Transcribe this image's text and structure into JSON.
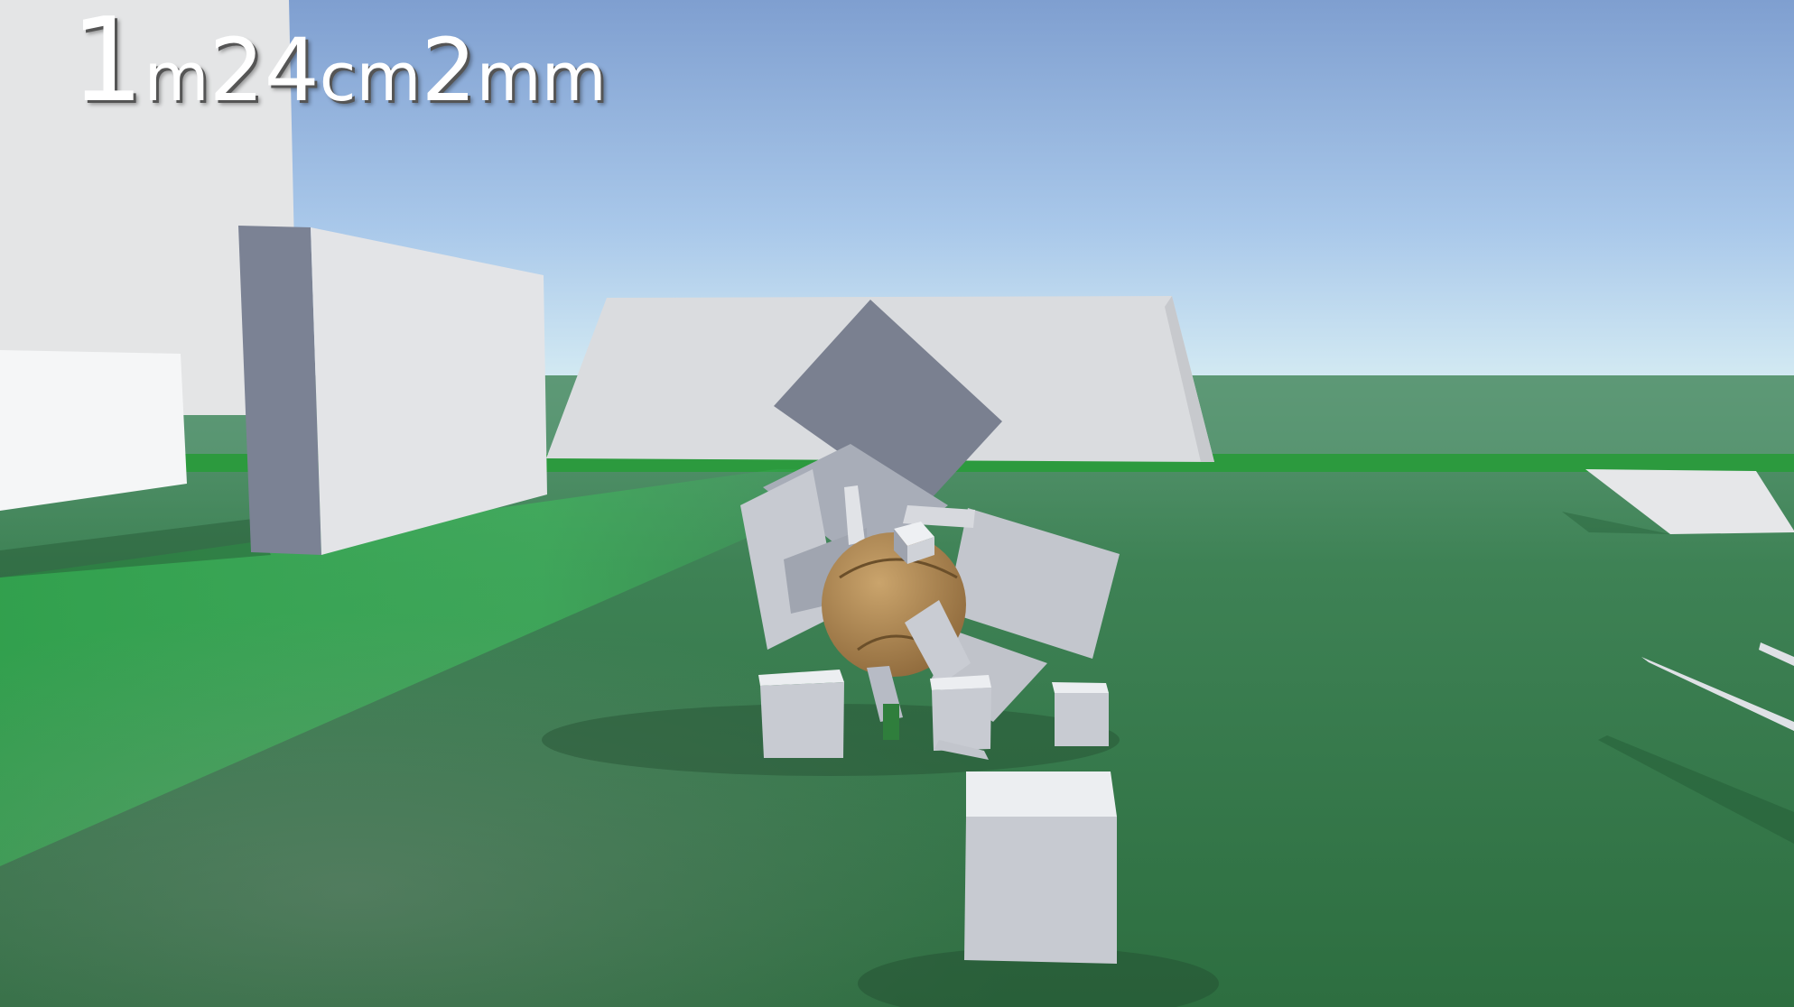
{
  "hud": {
    "meters": "1",
    "meters_unit": "m",
    "centimeters": "24",
    "centimeters_unit": "cm",
    "millimeters": "2",
    "millimeters_unit": "mm"
  },
  "colors": {
    "sky_top": "#84a4d4",
    "sky_horizon": "#cfe6f2",
    "ground_far": "#4f8e6a",
    "ground_near": "#2f7243",
    "green_stripe": "#2fa84a",
    "block_light": "#e1e3e7",
    "block_shade": "#7d8394",
    "ball": "#b48c55"
  },
  "icons": {
    "player": "ball-icon"
  }
}
